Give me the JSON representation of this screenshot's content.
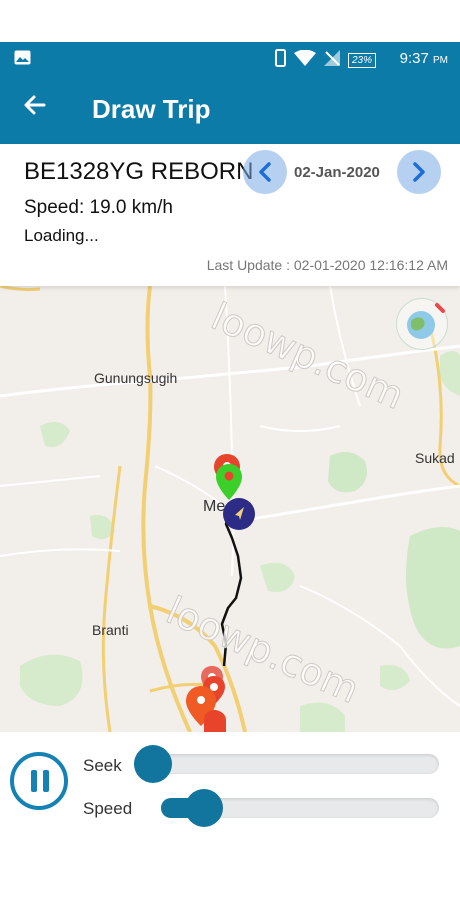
{
  "status": {
    "time": "9:37",
    "time_suffix": "PM",
    "battery": "23%"
  },
  "appbar": {
    "title": "Draw Trip"
  },
  "card": {
    "vehicle": "BE1328YG REBORN",
    "date": "02-Jan-2020",
    "speed": "Speed: 19.0 km/h",
    "loading": "Loading...",
    "last_update": "Last Update : 02-01-2020 12:16:12 AM"
  },
  "map": {
    "places": {
      "gunungsugih": "Gunungsugih",
      "sukad": "Sukad",
      "branti": "Branti",
      "metro": "Me"
    },
    "watermark": "loowp.com"
  },
  "controls": {
    "seek_label": "Seek",
    "speed_label": "Speed",
    "seek_value": 0.0,
    "speed_value": 0.1
  },
  "colors": {
    "primary": "#0c7ba8",
    "accent": "#11759e",
    "route": "#111111",
    "marker_green": "#3ccf2a",
    "marker_red": "#e8442c"
  }
}
